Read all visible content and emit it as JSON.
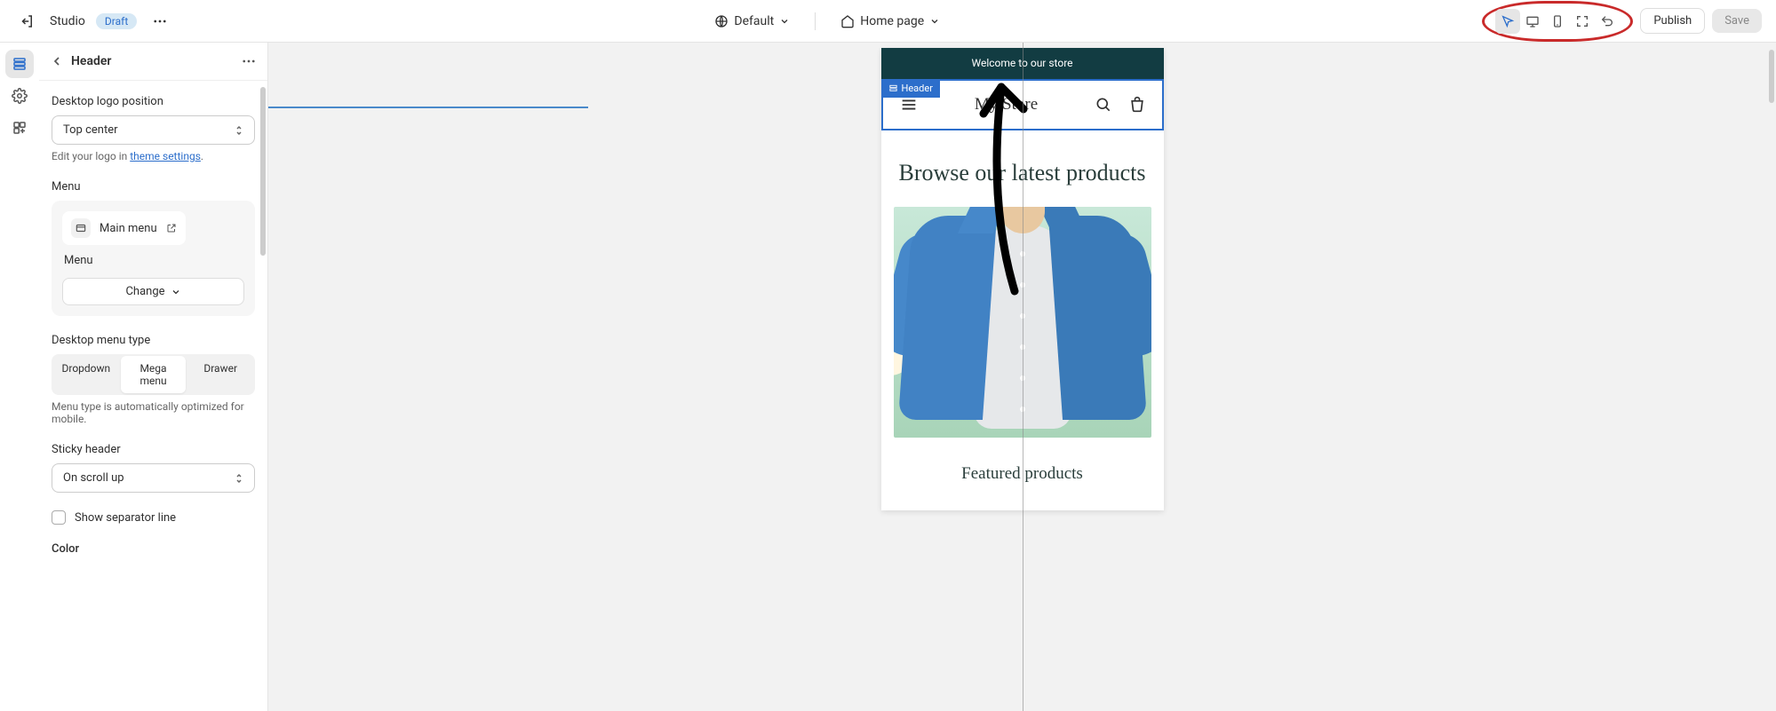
{
  "topbar": {
    "theme_name": "Studio",
    "draft_label": "Draft",
    "locale_label": "Default",
    "page_label": "Home page",
    "publish_label": "Publish",
    "save_label": "Save"
  },
  "sidebar": {
    "title": "Header",
    "logo_position": {
      "label": "Desktop logo position",
      "value": "Top center",
      "help_prefix": "Edit your logo in ",
      "help_link": "theme settings",
      "help_suffix": "."
    },
    "menu_section": {
      "label": "Menu",
      "item_label": "Main menu",
      "sub_label": "Menu",
      "change_label": "Change"
    },
    "menu_type": {
      "label": "Desktop menu type",
      "options": [
        "Dropdown",
        "Mega menu",
        "Drawer"
      ],
      "active_index": 1,
      "help": "Menu type is automatically optimized for mobile."
    },
    "sticky": {
      "label": "Sticky header",
      "value": "On scroll up"
    },
    "separator": {
      "label": "Show separator line",
      "checked": false
    },
    "color_label": "Color"
  },
  "preview": {
    "announcement": "Welcome to our store",
    "header_tag": "Header",
    "store_name": "My Store",
    "heading": "Browse our latest products",
    "featured": "Featured products"
  },
  "colors": {
    "accent": "#2c6ecb",
    "announcement_bg": "#123c42",
    "annotation_red": "#c92a2a"
  }
}
